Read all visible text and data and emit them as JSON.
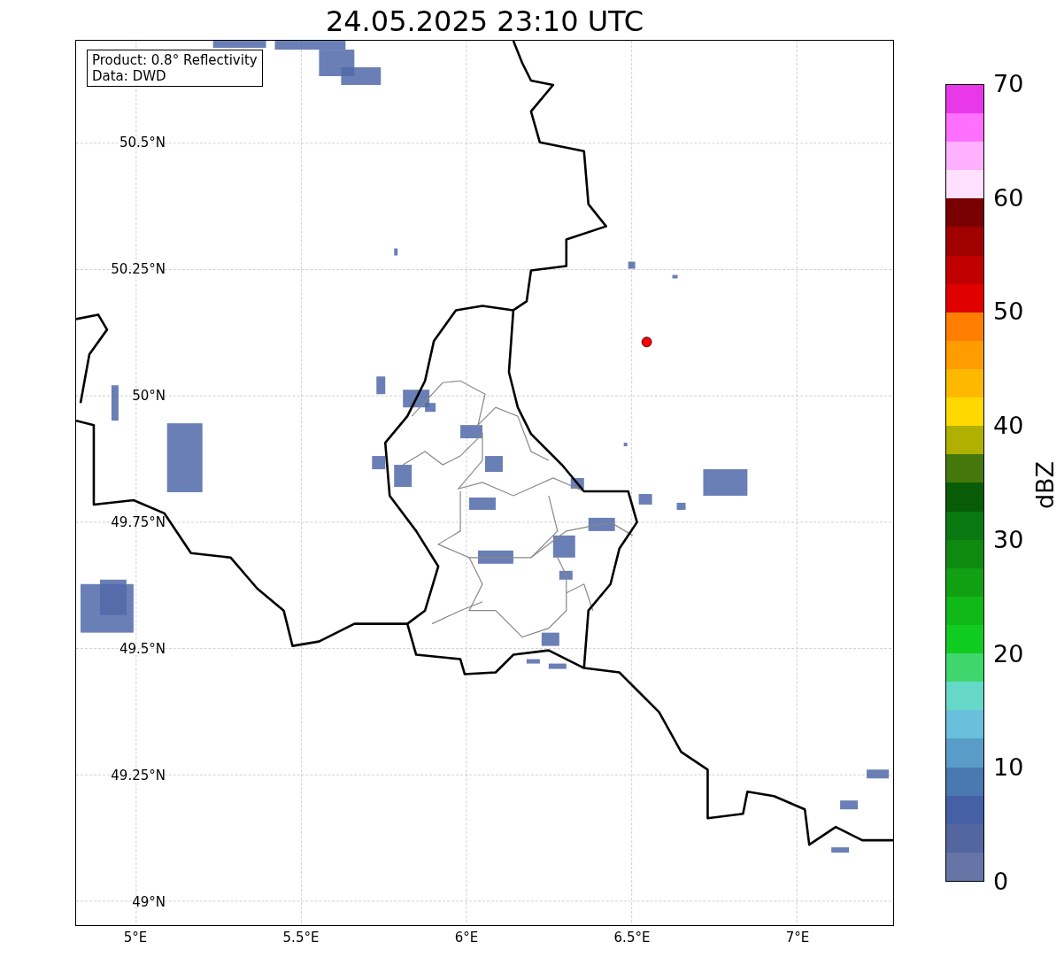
{
  "title": "24.05.2025 23:10 UTC",
  "map": {
    "info_box": [
      "Product: 0.8° Reflectivity",
      "Data: DWD"
    ],
    "lat_ticks": [
      "50.5°N",
      "50.25°N",
      "50°N",
      "49.75°N",
      "49.5°N",
      "49.25°N",
      "49°N"
    ],
    "lon_ticks": [
      "5°E",
      "5.5°E",
      "6°E",
      "6.5°E",
      "7°E"
    ],
    "marker": {
      "color": "#ff0000"
    }
  },
  "colorbar": {
    "label": "dBZ",
    "ticks": [
      "70",
      "60",
      "50",
      "40",
      "30",
      "20",
      "10",
      "0"
    ],
    "bands": [
      {
        "color": "#6674a6"
      },
      {
        "color": "#5466a0"
      },
      {
        "color": "#4560a4"
      },
      {
        "color": "#4a78b0"
      },
      {
        "color": "#5a9cc8"
      },
      {
        "color": "#68c0dc"
      },
      {
        "color": "#66d8c8"
      },
      {
        "color": "#3fd66e"
      },
      {
        "color": "#10cc20"
      },
      {
        "color": "#10b818"
      },
      {
        "color": "#10a012"
      },
      {
        "color": "#0e8a10"
      },
      {
        "color": "#0a7810"
      },
      {
        "color": "#085c08"
      },
      {
        "color": "#44780a"
      },
      {
        "color": "#b0b000"
      },
      {
        "color": "#ffd800"
      },
      {
        "color": "#ffb800"
      },
      {
        "color": "#ff9c00"
      },
      {
        "color": "#ff7e00"
      },
      {
        "color": "#e00000"
      },
      {
        "color": "#c00000"
      },
      {
        "color": "#a00000"
      },
      {
        "color": "#780000"
      },
      {
        "color": "#ffe0ff"
      },
      {
        "color": "#ffb0ff"
      },
      {
        "color": "#ff70ff"
      },
      {
        "color": "#e838e8"
      }
    ]
  }
}
